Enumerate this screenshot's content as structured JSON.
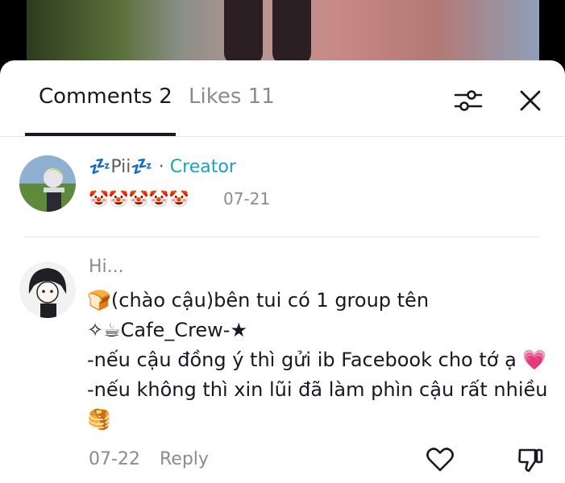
{
  "tabs": {
    "comments_label": "Comments 2",
    "likes_label": "Likes 11"
  },
  "icons": {
    "filter": "sliders-icon",
    "close": "close-icon",
    "like": "heart-icon",
    "dislike": "thumbs-down-icon"
  },
  "comments": [
    {
      "name": "💤Pii💤",
      "badge_separator": "·",
      "badge": "Creator",
      "text": "🤡🤡🤡🤡🤡",
      "date": "07-21"
    },
    {
      "name": "Hi...",
      "lines": [
        "🍞(chào cậu)bên tui có 1 group tên",
        "✧☕Cafe_Crew-★",
        "-nếu cậu đồng ý thì gửi ib Facebook cho tớ ạ 💗",
        "-nếu không thì xin lũi đã làm phìn cậu rất nhiều",
        "🥞"
      ],
      "date": "07-22",
      "reply_label": "Reply"
    }
  ],
  "colors": {
    "creator": "#1ca0c4",
    "text_primary": "#161823",
    "text_secondary": "#8a8b91"
  }
}
